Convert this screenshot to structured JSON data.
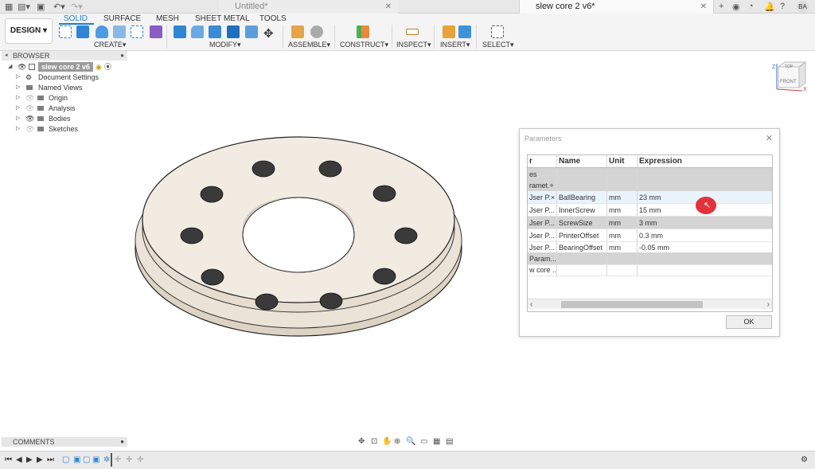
{
  "top_bar": {
    "untitled_tab": "Untitled*",
    "active_tab": "slew core 2 v6*",
    "user_initials": "BA"
  },
  "toolbar": {
    "design_label": "DESIGN",
    "workspace_tabs": [
      "SOLID",
      "SURFACE",
      "MESH",
      "SHEET METAL",
      "TOOLS"
    ],
    "groups": [
      "CREATE",
      "MODIFY",
      "ASSEMBLE",
      "CONSTRUCT",
      "INSPECT",
      "INSERT",
      "SELECT"
    ]
  },
  "browser": {
    "title": "BROWSER",
    "root": "slew core 2 v6",
    "items": [
      "Document Settings",
      "Named Views",
      "Origin",
      "Analysis",
      "Bodies",
      "Sketches"
    ]
  },
  "viewcube": {
    "top": "TOP",
    "front": "FRONT",
    "z": "Z",
    "x": "X"
  },
  "parameters": {
    "title": "Parameters",
    "columns": [
      "r",
      "Name",
      "Unit",
      "Expression"
    ],
    "rows": [
      {
        "type": "group",
        "c0": "es",
        "c1": "",
        "c2": "",
        "c3": ""
      },
      {
        "type": "group",
        "c0": "ramet.+",
        "c1": "",
        "c2": "",
        "c3": ""
      },
      {
        "type": "selected",
        "c0": "Jser P.×",
        "c1": "BallBearing",
        "c2": "mm",
        "c3": "23 mm"
      },
      {
        "type": "normal",
        "c0": "Jser P...",
        "c1": "InnerScrew",
        "c2": "mm",
        "c3": "15 mm"
      },
      {
        "type": "group",
        "c0": "Jser P...",
        "c1": "ScrewSize",
        "c2": "mm",
        "c3": "3 mm"
      },
      {
        "type": "normal",
        "c0": "Jser P...",
        "c1": "PrinterOffset",
        "c2": "mm",
        "c3": "0.3 mm"
      },
      {
        "type": "normal",
        "c0": "Jser P...",
        "c1": "BearingOffset",
        "c2": "mm",
        "c3": "-0.05 mm"
      },
      {
        "type": "group",
        "c0": "Param...",
        "c1": "",
        "c2": "",
        "c3": ""
      },
      {
        "type": "normal",
        "c0": "w core ...",
        "c1": "",
        "c2": "",
        "c3": ""
      }
    ],
    "ok_label": "OK"
  },
  "comments": {
    "title": "COMMENTS"
  }
}
